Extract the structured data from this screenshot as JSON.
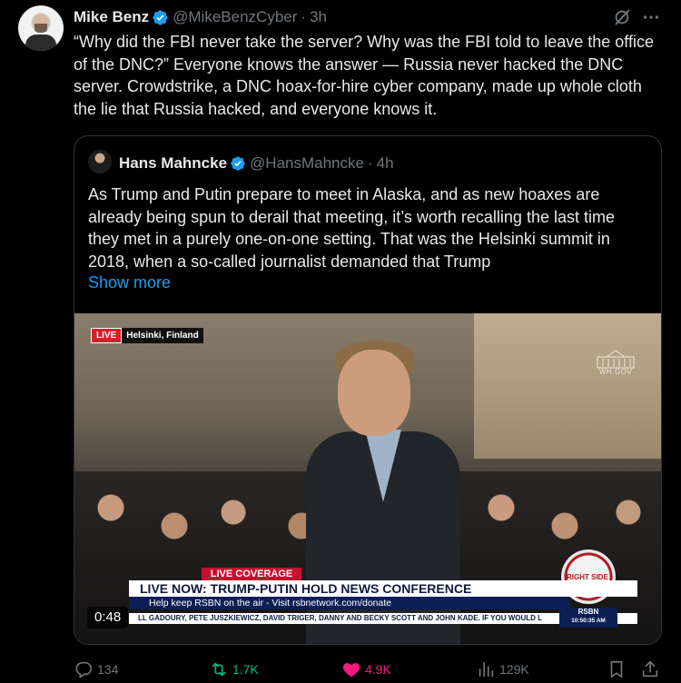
{
  "tweet": {
    "author_name": "Mike Benz",
    "author_handle": "@MikeBenzCyber",
    "time": "3h",
    "separator": "·",
    "text": "“Why did the FBI never take the server? Why was the FBI told to leave the office of the DNC?” Everyone knows the answer — Russia never hacked the DNC server. Crowdstrike, a DNC hoax-for-hire cyber company, made up whole cloth the lie that Russia hacked, and everyone knows it."
  },
  "quote": {
    "author_name": "Hans Mahncke",
    "author_handle": "@HansMahncke",
    "time": "4h",
    "separator": "·",
    "text": "As Trump and Putin prepare to meet in Alaska, and as new hoaxes are already being spun to derail that meeting, it’s worth recalling the last time they met in a purely one-on-one setting. That was the Helsinki summit in 2018, when a so-called journalist demanded that Trump",
    "show_more": "Show more"
  },
  "video": {
    "live_label": "LIVE",
    "location": "Helsinki, Finland",
    "wh_text": "WH.GOV",
    "coverage": "LIVE COVERAGE",
    "headline": "LIVE NOW: TRUMP-PUTIN HOLD NEWS CONFERENCE",
    "subline": "Help keep RSBN on the air - Visit rsbnetwork.com/donate",
    "ticker": "LL GADOURY, PETE JUSZKIEWICZ, DAVID TRIGER, DANNY AND BECKY SCOTT AND JOHN KADE.   IF YOU WOULD L",
    "badge_name": "RSBN",
    "badge_time": "10:50:35 AM",
    "logo_text": "RIGHT SIDE",
    "timestamp": "0:48"
  },
  "actions": {
    "replies": "134",
    "reposts": "1.7K",
    "likes": "4.9K",
    "views": "129K"
  },
  "colors": {
    "accent_blue": "#1d9bf0",
    "repost_green": "#00ba7c",
    "like_pink": "#f91880",
    "muted": "#71767b"
  },
  "icons": [
    "verified-badge-icon",
    "grok-icon",
    "more-icon",
    "reply-icon",
    "repost-icon",
    "like-icon",
    "views-icon",
    "bookmark-icon",
    "share-icon"
  ]
}
